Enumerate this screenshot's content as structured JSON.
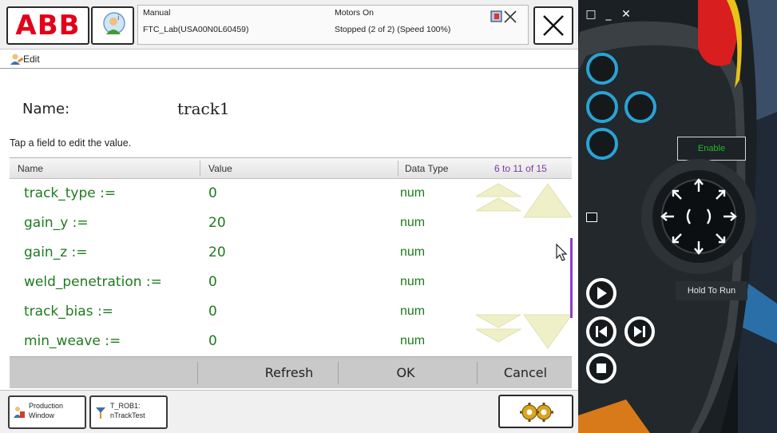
{
  "topbar": {
    "logo_text": "ABB",
    "mode": "Manual",
    "controller": "FTC_Lab(USA00N0L60459)",
    "motors": "Motors On",
    "state": "Stopped (2 of 2) (Speed 100%)"
  },
  "edit_bar": {
    "label": "Edit"
  },
  "form": {
    "name_label": "Name:",
    "name_value": "track1",
    "instructions": "Tap a field to edit the value."
  },
  "table": {
    "headers": {
      "name": "Name",
      "value": "Value",
      "type": "Data Type"
    },
    "range": "6 to 11 of 15",
    "rows": [
      {
        "name": "track_type :=",
        "value": "0",
        "type": "num"
      },
      {
        "name": "gain_y :=",
        "value": "20",
        "type": "num"
      },
      {
        "name": "gain_z :=",
        "value": "20",
        "type": "num"
      },
      {
        "name": "weld_penetration :=",
        "value": "0",
        "type": "num"
      },
      {
        "name": "track_bias :=",
        "value": "0",
        "type": "num"
      },
      {
        "name": "min_weave :=",
        "value": "0",
        "type": "num"
      }
    ]
  },
  "commands": {
    "refresh": "Refresh",
    "ok": "OK",
    "cancel": "Cancel"
  },
  "taskbar": {
    "production_window": "Production\nWindow",
    "program_task": "T_ROB1:\nnTrackTest"
  },
  "hardware": {
    "window_controls": [
      "□",
      "_",
      "✕"
    ],
    "enable_label": "Enable",
    "hold_label": "Hold To Run"
  },
  "colors": {
    "abb_red": "#e2001a",
    "data_green": "#1f7a1f",
    "range_purple": "#7a3aa6",
    "hw_blue": "#2aa3d4",
    "enable_green": "#28b428"
  },
  "icons": {
    "user": "user-icon",
    "close": "close-icon",
    "edit": "edit-icon",
    "quickset": "quickset-icon",
    "joystick": "joystick-icon"
  }
}
